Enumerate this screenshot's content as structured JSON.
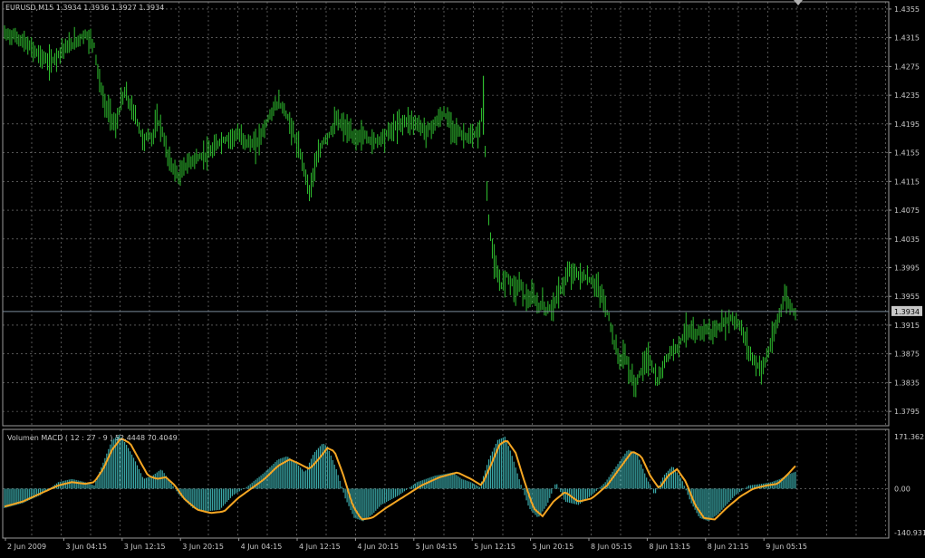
{
  "symbol_header": "EURUSD,M15  1.3934 1.3936 1.3927 1.3934",
  "indicator_header": "Volumen MACD ( 12 : 27 - 9 ) 52.4448 70.4049",
  "current_price_label": "1.3934",
  "colors": {
    "background": "#000000",
    "grid": "#8a8a8a",
    "price_bars": "#2fbf2f",
    "macd_histogram": "#3aa8a8",
    "signal_line": "#f5a623",
    "current_price_line": "#7a8a9a",
    "axis_text": "#c8c8c8",
    "border": "#9a9a9a"
  },
  "chart_data": [
    {
      "type": "bar",
      "name_label": "EURUSD,M15",
      "ylim": [
        1.3775,
        1.4365
      ],
      "y_ticks": [
        "1.4355",
        "1.4315",
        "1.4275",
        "1.4235",
        "1.4195",
        "1.4155",
        "1.4115",
        "1.4075",
        "1.4035",
        "1.3995",
        "1.3955",
        "1.3915",
        "1.3875",
        "1.3835",
        "1.3795"
      ],
      "current_price": 1.3934,
      "x_labels": [
        "2 Jun 2009",
        "3 Jun 04:15",
        "3 Jun 12:15",
        "3 Jun 20:15",
        "4 Jun 04:15",
        "4 Jun 12:15",
        "4 Jun 20:15",
        "5 Jun 04:15",
        "5 Jun 12:15",
        "5 Jun 20:15",
        "8 Jun 05:15",
        "8 Jun 13:15",
        "8 Jun 21:15",
        "9 Jun 05:15"
      ],
      "close_path": [
        [
          0,
          1.432
        ],
        [
          10,
          1.4318
        ],
        [
          20,
          1.431
        ],
        [
          30,
          1.43
        ],
        [
          40,
          1.429
        ],
        [
          50,
          1.428
        ],
        [
          55,
          1.4285
        ],
        [
          65,
          1.43
        ],
        [
          75,
          1.4305
        ],
        [
          85,
          1.4315
        ],
        [
          90,
          1.432
        ],
        [
          100,
          1.4305
        ],
        [
          105,
          1.426
        ],
        [
          112,
          1.422
        ],
        [
          118,
          1.421
        ],
        [
          124,
          1.419
        ],
        [
          130,
          1.4225
        ],
        [
          135,
          1.424
        ],
        [
          140,
          1.422
        ],
        [
          145,
          1.421
        ],
        [
          150,
          1.419
        ],
        [
          155,
          1.417
        ],
        [
          160,
          1.418
        ],
        [
          165,
          1.4175
        ],
        [
          170,
          1.42
        ],
        [
          175,
          1.419
        ],
        [
          180,
          1.416
        ],
        [
          185,
          1.414
        ],
        [
          190,
          1.413
        ],
        [
          195,
          1.412
        ],
        [
          200,
          1.4135
        ],
        [
          210,
          1.4145
        ],
        [
          220,
          1.415
        ],
        [
          230,
          1.4155
        ],
        [
          240,
          1.417
        ],
        [
          250,
          1.4175
        ],
        [
          260,
          1.418
        ],
        [
          270,
          1.417
        ],
        [
          280,
          1.4165
        ],
        [
          290,
          1.419
        ],
        [
          297,
          1.421
        ],
        [
          305,
          1.4225
        ],
        [
          312,
          1.4215
        ],
        [
          320,
          1.419
        ],
        [
          328,
          1.416
        ],
        [
          335,
          1.413
        ],
        [
          340,
          1.41
        ],
        [
          345,
          1.413
        ],
        [
          350,
          1.415
        ],
        [
          355,
          1.417
        ],
        [
          362,
          1.418
        ],
        [
          370,
          1.42
        ],
        [
          380,
          1.419
        ],
        [
          390,
          1.4175
        ],
        [
          400,
          1.418
        ],
        [
          410,
          1.417
        ],
        [
          420,
          1.4175
        ],
        [
          430,
          1.4185
        ],
        [
          440,
          1.4195
        ],
        [
          450,
          1.42
        ],
        [
          460,
          1.4195
        ],
        [
          470,
          1.4185
        ],
        [
          480,
          1.4195
        ],
        [
          490,
          1.421
        ],
        [
          500,
          1.419
        ],
        [
          510,
          1.418
        ],
        [
          520,
          1.4175
        ],
        [
          530,
          1.4185
        ],
        [
          534,
          1.423
        ],
        [
          537,
          1.412
        ],
        [
          540,
          1.406
        ],
        [
          545,
          1.401
        ],
        [
          550,
          1.398
        ],
        [
          555,
          1.397
        ],
        [
          560,
          1.3985
        ],
        [
          565,
          1.3975
        ],
        [
          570,
          1.3965
        ],
        [
          575,
          1.3975
        ],
        [
          580,
          1.3955
        ],
        [
          585,
          1.395
        ],
        [
          590,
          1.3955
        ],
        [
          595,
          1.394
        ],
        [
          600,
          1.3945
        ],
        [
          605,
          1.3935
        ],
        [
          610,
          1.394
        ],
        [
          615,
          1.395
        ],
        [
          620,
          1.3965
        ],
        [
          625,
          1.3975
        ],
        [
          630,
          1.399
        ],
        [
          640,
          1.3985
        ],
        [
          650,
          1.398
        ],
        [
          660,
          1.397
        ],
        [
          668,
          1.395
        ],
        [
          675,
          1.392
        ],
        [
          680,
          1.389
        ],
        [
          686,
          1.3865
        ],
        [
          692,
          1.3875
        ],
        [
          698,
          1.3845
        ],
        [
          703,
          1.383
        ],
        [
          708,
          1.3845
        ],
        [
          713,
          1.386
        ],
        [
          718,
          1.387
        ],
        [
          723,
          1.3855
        ],
        [
          728,
          1.3835
        ],
        [
          733,
          1.385
        ],
        [
          738,
          1.387
        ],
        [
          745,
          1.388
        ],
        [
          750,
          1.3885
        ],
        [
          755,
          1.3895
        ],
        [
          760,
          1.391
        ],
        [
          770,
          1.39
        ],
        [
          780,
          1.391
        ],
        [
          790,
          1.3905
        ],
        [
          800,
          1.3915
        ],
        [
          810,
          1.3925
        ],
        [
          820,
          1.3915
        ],
        [
          825,
          1.39
        ],
        [
          830,
          1.388
        ],
        [
          838,
          1.386
        ],
        [
          845,
          1.3855
        ],
        [
          850,
          1.387
        ],
        [
          855,
          1.389
        ],
        [
          860,
          1.391
        ],
        [
          865,
          1.3935
        ],
        [
          870,
          1.3955
        ],
        [
          875,
          1.3945
        ],
        [
          880,
          1.3934
        ]
      ]
    },
    {
      "type": "bar",
      "name_label": "Volumen MACD ( 12 : 27 - 9 )",
      "ylim": [
        -140.931,
        171.362
      ],
      "y_ticks": [
        "171.362",
        "0.00",
        "-140.931"
      ],
      "macd_main": 52.4448,
      "signal": 70.4049,
      "histogram_path": [
        [
          0,
          -60
        ],
        [
          20,
          -45
        ],
        [
          40,
          -20
        ],
        [
          60,
          20
        ],
        [
          75,
          30
        ],
        [
          90,
          20
        ],
        [
          100,
          10
        ],
        [
          110,
          80
        ],
        [
          120,
          150
        ],
        [
          128,
          165
        ],
        [
          135,
          140
        ],
        [
          145,
          90
        ],
        [
          155,
          30
        ],
        [
          165,
          40
        ],
        [
          175,
          60
        ],
        [
          185,
          20
        ],
        [
          195,
          -20
        ],
        [
          210,
          -60
        ],
        [
          225,
          -70
        ],
        [
          240,
          -65
        ],
        [
          255,
          -20
        ],
        [
          270,
          5
        ],
        [
          290,
          50
        ],
        [
          305,
          90
        ],
        [
          315,
          100
        ],
        [
          325,
          80
        ],
        [
          335,
          50
        ],
        [
          345,
          110
        ],
        [
          355,
          140
        ],
        [
          360,
          130
        ],
        [
          370,
          60
        ],
        [
          380,
          -30
        ],
        [
          390,
          -90
        ],
        [
          400,
          -100
        ],
        [
          410,
          -80
        ],
        [
          420,
          -50
        ],
        [
          440,
          -20
        ],
        [
          460,
          20
        ],
        [
          480,
          40
        ],
        [
          500,
          50
        ],
        [
          510,
          30
        ],
        [
          520,
          20
        ],
        [
          530,
          5
        ],
        [
          540,
          90
        ],
        [
          550,
          150
        ],
        [
          558,
          160
        ],
        [
          565,
          110
        ],
        [
          575,
          20
        ],
        [
          585,
          -60
        ],
        [
          595,
          -90
        ],
        [
          605,
          -50
        ],
        [
          615,
          20
        ],
        [
          625,
          -40
        ],
        [
          640,
          -50
        ],
        [
          655,
          -20
        ],
        [
          670,
          20
        ],
        [
          685,
          80
        ],
        [
          695,
          120
        ],
        [
          705,
          110
        ],
        [
          715,
          40
        ],
        [
          725,
          -20
        ],
        [
          735,
          40
        ],
        [
          745,
          70
        ],
        [
          755,
          30
        ],
        [
          765,
          -40
        ],
        [
          775,
          -90
        ],
        [
          785,
          -100
        ],
        [
          795,
          -80
        ],
        [
          805,
          -50
        ],
        [
          815,
          -20
        ],
        [
          830,
          10
        ],
        [
          845,
          15
        ],
        [
          855,
          20
        ],
        [
          865,
          30
        ],
        [
          875,
          45
        ],
        [
          882,
          52
        ]
      ],
      "signal_path": [
        [
          0,
          -55
        ],
        [
          20,
          -40
        ],
        [
          40,
          -15
        ],
        [
          60,
          10
        ],
        [
          75,
          20
        ],
        [
          90,
          15
        ],
        [
          100,
          20
        ],
        [
          110,
          60
        ],
        [
          120,
          120
        ],
        [
          130,
          155
        ],
        [
          140,
          140
        ],
        [
          150,
          90
        ],
        [
          160,
          40
        ],
        [
          170,
          30
        ],
        [
          180,
          35
        ],
        [
          190,
          10
        ],
        [
          200,
          -30
        ],
        [
          215,
          -65
        ],
        [
          230,
          -75
        ],
        [
          245,
          -70
        ],
        [
          260,
          -30
        ],
        [
          275,
          0
        ],
        [
          290,
          30
        ],
        [
          305,
          70
        ],
        [
          318,
          90
        ],
        [
          330,
          75
        ],
        [
          340,
          60
        ],
        [
          350,
          90
        ],
        [
          360,
          125
        ],
        [
          368,
          115
        ],
        [
          378,
          40
        ],
        [
          388,
          -50
        ],
        [
          398,
          -95
        ],
        [
          410,
          -90
        ],
        [
          425,
          -60
        ],
        [
          445,
          -25
        ],
        [
          465,
          10
        ],
        [
          485,
          35
        ],
        [
          505,
          50
        ],
        [
          520,
          30
        ],
        [
          532,
          10
        ],
        [
          542,
          70
        ],
        [
          552,
          135
        ],
        [
          560,
          150
        ],
        [
          570,
          110
        ],
        [
          580,
          20
        ],
        [
          590,
          -60
        ],
        [
          600,
          -85
        ],
        [
          612,
          -40
        ],
        [
          625,
          -10
        ],
        [
          640,
          -40
        ],
        [
          655,
          -30
        ],
        [
          672,
          10
        ],
        [
          688,
          70
        ],
        [
          700,
          115
        ],
        [
          710,
          100
        ],
        [
          720,
          40
        ],
        [
          730,
          0
        ],
        [
          740,
          40
        ],
        [
          750,
          60
        ],
        [
          760,
          20
        ],
        [
          770,
          -50
        ],
        [
          780,
          -90
        ],
        [
          792,
          -95
        ],
        [
          805,
          -60
        ],
        [
          820,
          -25
        ],
        [
          835,
          0
        ],
        [
          850,
          10
        ],
        [
          862,
          15
        ],
        [
          872,
          40
        ],
        [
          882,
          70
        ]
      ]
    }
  ]
}
